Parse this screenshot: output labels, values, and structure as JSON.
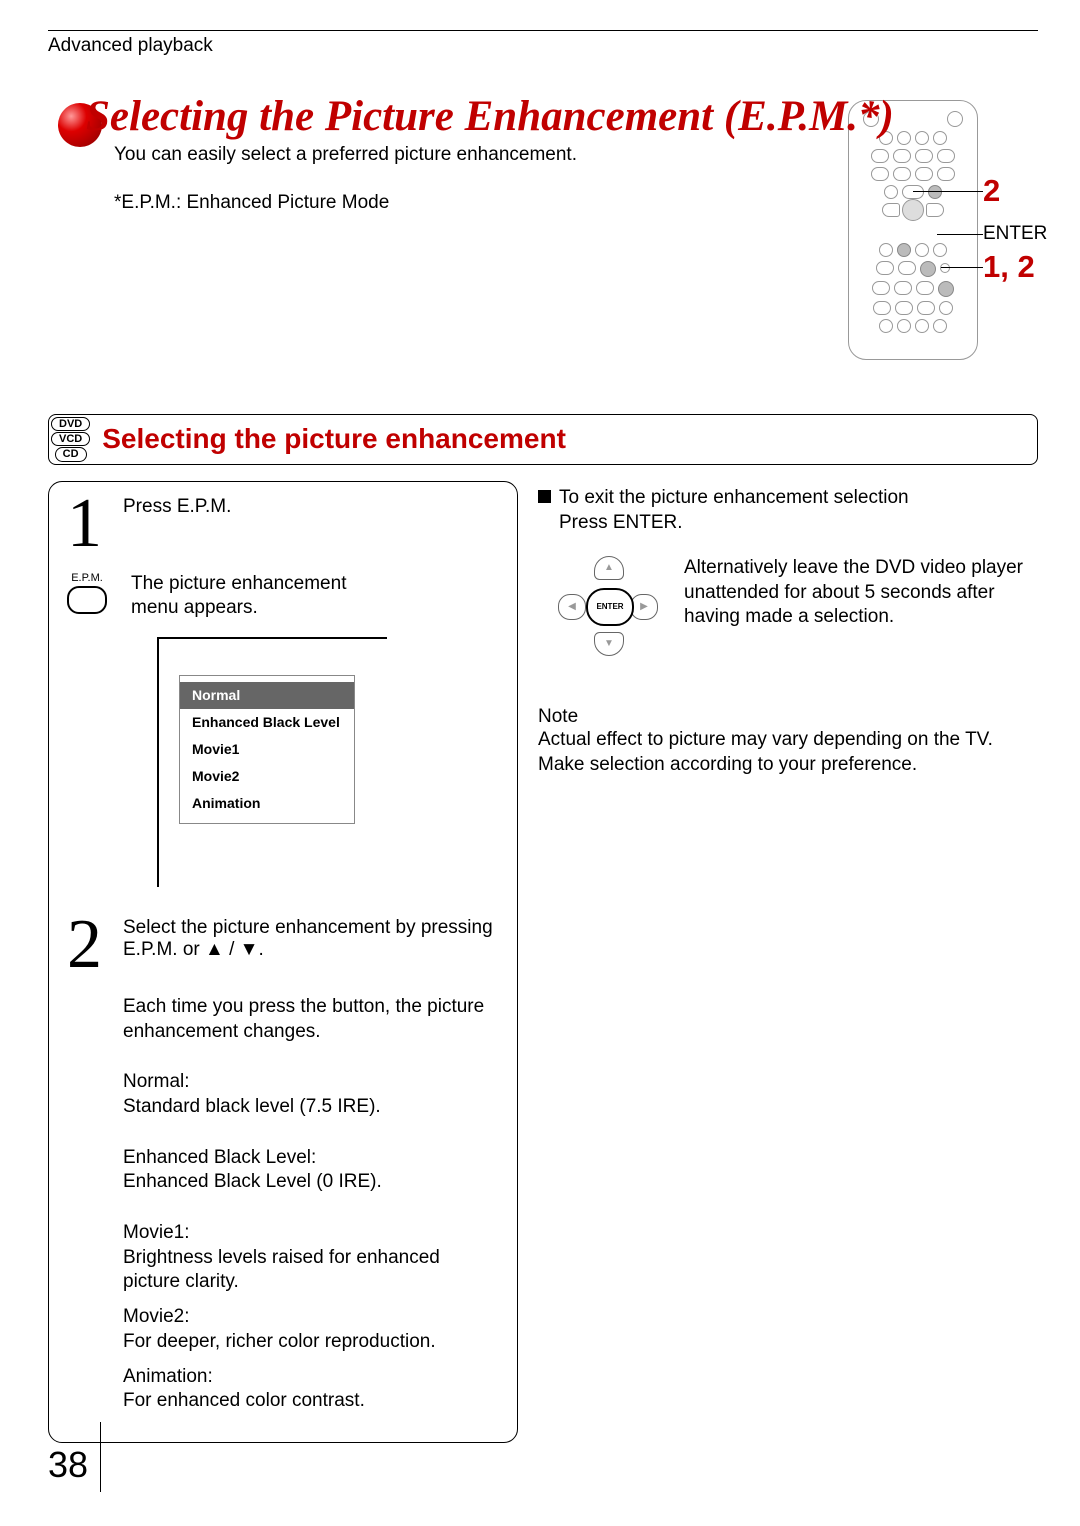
{
  "header": {
    "section": "Advanced playback"
  },
  "title": "Selecting the Picture Enhancement (E.P.M.*)",
  "intro": "You can easily select a preferred picture enhancement.",
  "asterisk": "*E.P.M.: Enhanced Picture Mode",
  "remote_callouts": {
    "top": "2",
    "enter": "ENTER",
    "combo": "1, 2"
  },
  "section": {
    "badges": [
      "DVD",
      "VCD",
      "CD"
    ],
    "heading": "Selecting the picture enhancement"
  },
  "step1": {
    "num": "1",
    "title": "Press E.P.M.",
    "button_label": "E.P.M.",
    "result": "The picture enhancement menu appears.",
    "menu": [
      "Normal",
      "Enhanced Black Level",
      "Movie1",
      "Movie2",
      "Animation"
    ]
  },
  "step2": {
    "num": "2",
    "title": "Select the picture enhancement by pressing E.P.M. or ▲ / ▼.",
    "detail": "Each time you press the button, the picture enhancement changes.",
    "modes": [
      {
        "name": "Normal:",
        "desc": "Standard black level (7.5 IRE)."
      },
      {
        "name": "Enhanced Black Level:",
        "desc": "Enhanced Black Level (0 IRE)."
      },
      {
        "name": "Movie1:",
        "desc": "Brightness levels raised for enhanced picture clarity."
      },
      {
        "name": "Movie2:",
        "desc": "For deeper, richer color reproduction."
      },
      {
        "name": "Animation:",
        "desc": "For enhanced color contrast."
      }
    ]
  },
  "right": {
    "exit_title": "To exit the picture enhancement selection",
    "exit_action": "Press ENTER.",
    "enter_label": "ENTER",
    "alt_text": "Alternatively leave the DVD video player unattended for about 5 seconds after having made a selection.",
    "note_head": "Note",
    "note_body": "Actual effect to picture may vary depending on the TV.  Make selection according to your preference."
  },
  "page_number": "38"
}
